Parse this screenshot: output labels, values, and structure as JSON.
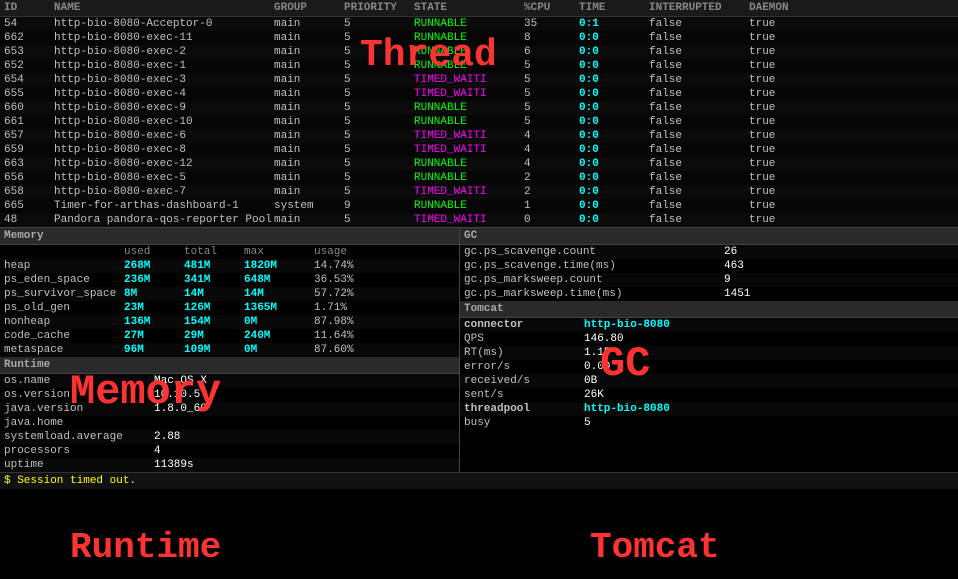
{
  "labels": {
    "thread": "Thread",
    "memory_section": "Memory",
    "gc_section": "GC",
    "runtime_section": "Runtime",
    "tomcat_section": "Tomcat"
  },
  "thread": {
    "columns": [
      "ID",
      "NAME",
      "GROUP",
      "PRIORITY",
      "STATE",
      "%CPU",
      "TIME",
      "INTERRUPTED",
      "DAEMON"
    ],
    "rows": [
      {
        "id": "54",
        "name": "http-bio-8080-Acceptor-0",
        "group": "main",
        "priority": "5",
        "state": "RUNNABLE",
        "cpu": "35",
        "time": "0:1",
        "interrupted": "false",
        "daemon": "true"
      },
      {
        "id": "662",
        "name": "http-bio-8080-exec-11",
        "group": "main",
        "priority": "5",
        "state": "RUNNABLE",
        "cpu": "8",
        "time": "0:0",
        "interrupted": "false",
        "daemon": "true"
      },
      {
        "id": "653",
        "name": "http-bio-8080-exec-2",
        "group": "main",
        "priority": "5",
        "state": "RUNNABLE",
        "cpu": "6",
        "time": "0:0",
        "interrupted": "false",
        "daemon": "true"
      },
      {
        "id": "652",
        "name": "http-bio-8080-exec-1",
        "group": "main",
        "priority": "5",
        "state": "RUNNABLE",
        "cpu": "5",
        "time": "0:0",
        "interrupted": "false",
        "daemon": "true"
      },
      {
        "id": "654",
        "name": "http-bio-8080-exec-3",
        "group": "main",
        "priority": "5",
        "state": "TIMED_WAIT",
        "cpu": "5",
        "time": "0:0",
        "interrupted": "false",
        "daemon": "true"
      },
      {
        "id": "655",
        "name": "http-bio-8080-exec-4",
        "group": "main",
        "priority": "5",
        "state": "TIMED_WAIT",
        "cpu": "5",
        "time": "0:0",
        "interrupted": "false",
        "daemon": "true"
      },
      {
        "id": "660",
        "name": "http-bio-8080-exec-9",
        "group": "main",
        "priority": "5",
        "state": "RUNNABLE",
        "cpu": "5",
        "time": "0:0",
        "interrupted": "false",
        "daemon": "true"
      },
      {
        "id": "661",
        "name": "http-bio-8080-exec-10",
        "group": "main",
        "priority": "5",
        "state": "RUNNABLE",
        "cpu": "5",
        "time": "0:0",
        "interrupted": "false",
        "daemon": "true"
      },
      {
        "id": "657",
        "name": "http-bio-8080-exec-6",
        "group": "main",
        "priority": "5",
        "state": "TIMED_WAIT",
        "cpu": "4",
        "time": "0:0",
        "interrupted": "false",
        "daemon": "true"
      },
      {
        "id": "659",
        "name": "http-bio-8080-exec-8",
        "group": "main",
        "priority": "5",
        "state": "TIMED_WAIT",
        "cpu": "4",
        "time": "0:0",
        "interrupted": "false",
        "daemon": "true"
      },
      {
        "id": "663",
        "name": "http-bio-8080-exec-12",
        "group": "main",
        "priority": "5",
        "state": "RUNNABLE",
        "cpu": "4",
        "time": "0:0",
        "interrupted": "false",
        "daemon": "true"
      },
      {
        "id": "656",
        "name": "http-bio-8080-exec-5",
        "group": "main",
        "priority": "5",
        "state": "RUNNABLE",
        "cpu": "2",
        "time": "0:0",
        "interrupted": "false",
        "daemon": "true"
      },
      {
        "id": "658",
        "name": "http-bio-8080-exec-7",
        "group": "main",
        "priority": "5",
        "state": "TIMED_WAIT",
        "cpu": "2",
        "time": "0:0",
        "interrupted": "false",
        "daemon": "true"
      },
      {
        "id": "665",
        "name": "Timer-for-arthas-dashboard-1",
        "group": "system",
        "priority": "9",
        "state": "RUNNABLE",
        "cpu": "1",
        "time": "0:0",
        "interrupted": "false",
        "daemon": "true"
      },
      {
        "id": "48",
        "name": "Pandora pandora-qos-reporter Pool",
        "group": "main",
        "priority": "5",
        "state": "TIMED_WAIT",
        "cpu": "0",
        "time": "0:0",
        "interrupted": "false",
        "daemon": "true"
      }
    ]
  },
  "memory": {
    "section": "Memory",
    "headers": [
      "Memory",
      "used",
      "total",
      "max",
      "usage"
    ],
    "rows": [
      {
        "name": "heap",
        "used": "268M",
        "total": "481M",
        "max": "1820M",
        "usage": "14.74%"
      },
      {
        "name": "ps_eden_space",
        "used": "236M",
        "total": "341M",
        "max": "648M",
        "usage": "36.53%"
      },
      {
        "name": "ps_survivor_space",
        "used": "8M",
        "total": "14M",
        "max": "14M",
        "usage": "57.72%"
      },
      {
        "name": "ps_old_gen",
        "used": "23M",
        "total": "126M",
        "max": "1365M",
        "usage": "1.71%"
      },
      {
        "name": "nonheap",
        "used": "136M",
        "total": "154M",
        "max": "0M",
        "usage": "87.98%"
      },
      {
        "name": "code_cache",
        "used": "27M",
        "total": "29M",
        "max": "240M",
        "usage": "11.64%"
      },
      {
        "name": "metaspace",
        "used": "96M",
        "total": "109M",
        "max": "0M",
        "usage": "87.60%"
      }
    ]
  },
  "gc": {
    "section": "GC",
    "rows": [
      {
        "name": "gc.ps_scavenge.count",
        "value": "26"
      },
      {
        "name": "gc.ps_scavenge.time(ms)",
        "value": "463"
      },
      {
        "name": "gc.ps_marksweep.count",
        "value": "9"
      },
      {
        "name": "gc.ps_marksweep.time(ms)",
        "value": "1451"
      }
    ]
  },
  "runtime": {
    "section": "Runtime",
    "rows": [
      {
        "name": "os.name",
        "value": "Mac OS X"
      },
      {
        "name": "os.version",
        "value": "10.10.5"
      },
      {
        "name": "java.version",
        "value": "1.8.0_60"
      },
      {
        "name": "java.home",
        "value": ""
      },
      {
        "name": "systemload.average",
        "value": "2.88"
      },
      {
        "name": "processors",
        "value": "4"
      },
      {
        "name": "uptime",
        "value": "11389s"
      }
    ]
  },
  "tomcat": {
    "section": "Tomcat",
    "rows": [
      {
        "name": "connector",
        "value": "http-bio-8080",
        "bold": true
      },
      {
        "name": "QPS",
        "value": "146.80",
        "bold": false
      },
      {
        "name": "RT(ms)",
        "value": "1.15",
        "bold": false
      },
      {
        "name": "error/s",
        "value": "0.00",
        "bold": false
      },
      {
        "name": "received/s",
        "value": "0B",
        "bold": false
      },
      {
        "name": "sent/s",
        "value": "26K",
        "bold": false
      },
      {
        "name": "threadpool",
        "value": "http-bio-8080",
        "bold": true
      },
      {
        "name": "busy",
        "value": "5",
        "bold": false
      }
    ]
  },
  "status": {
    "message": "$ Session timed out."
  }
}
